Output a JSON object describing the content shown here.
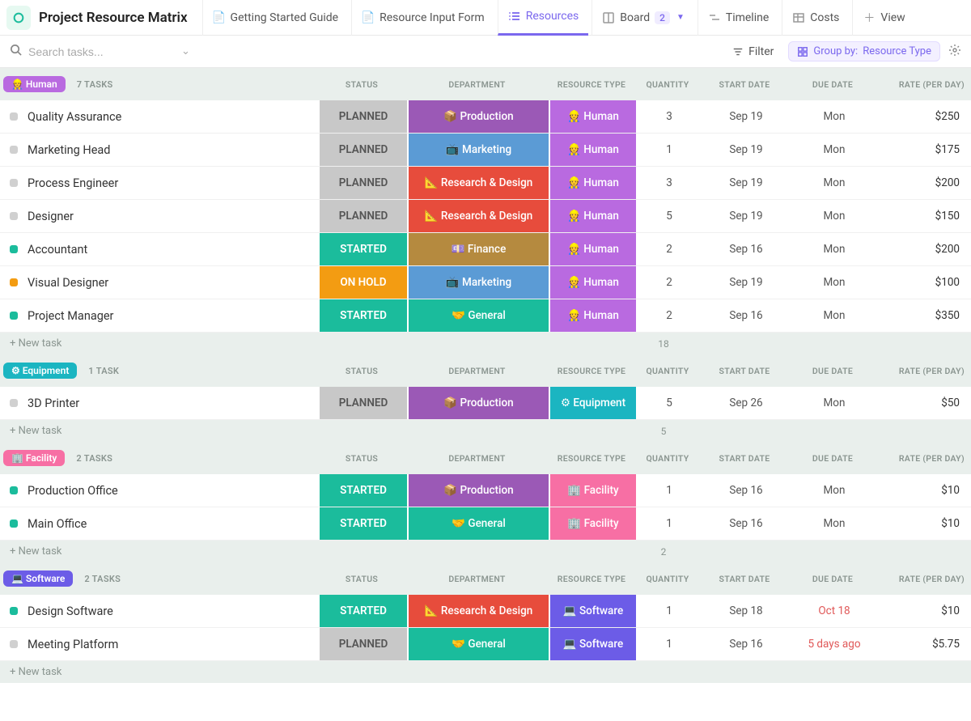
{
  "header": {
    "title": "Project Resource Matrix",
    "tabs": [
      {
        "icon": "doc-pin",
        "label": "Getting Started Guide"
      },
      {
        "icon": "doc-pin",
        "label": "Resource Input Form"
      },
      {
        "icon": "list",
        "label": "Resources",
        "active": true
      },
      {
        "icon": "board",
        "label": "Board",
        "count": "2"
      },
      {
        "icon": "timeline",
        "label": "Timeline"
      },
      {
        "icon": "table",
        "label": "Costs"
      },
      {
        "icon": "plus",
        "label": "View"
      }
    ]
  },
  "subbar": {
    "search_placeholder": "Search tasks...",
    "filter_label": "Filter",
    "groupby_prefix": "Group by:",
    "groupby_value": "Resource Type"
  },
  "columns": {
    "status": "STATUS",
    "department": "DEPARTMENT",
    "resource_type": "RESOURCE TYPE",
    "quantity": "QUANTITY",
    "start_date": "START DATE",
    "due_date": "DUE DATE",
    "rate": "RATE (PER DAY)"
  },
  "newtask_label": "+ New task",
  "groups": [
    {
      "pill_class": "pill-human",
      "pill_label": "👷 Human",
      "task_count": "7 TASKS",
      "rows": [
        {
          "name": "Quality Assurance",
          "status": "PLANNED",
          "status_class": "tag-planned",
          "sq": "sq-planned",
          "dept": "📦 Production",
          "dept_class": "dept-prod",
          "rtype": "👷 Human",
          "rtype_class": "rt-human",
          "qty": "3",
          "start": "Sep 19",
          "due": "Mon",
          "rate": "$250"
        },
        {
          "name": "Marketing Head",
          "status": "PLANNED",
          "status_class": "tag-planned",
          "sq": "sq-planned",
          "dept": "📺 Marketing",
          "dept_class": "dept-mkt",
          "rtype": "👷 Human",
          "rtype_class": "rt-human",
          "qty": "1",
          "start": "Sep 19",
          "due": "Mon",
          "rate": "$175"
        },
        {
          "name": "Process Engineer",
          "status": "PLANNED",
          "status_class": "tag-planned",
          "sq": "sq-planned",
          "dept": "📐 Research & Design",
          "dept_class": "dept-rd",
          "rtype": "👷 Human",
          "rtype_class": "rt-human",
          "qty": "3",
          "start": "Sep 19",
          "due": "Mon",
          "rate": "$200"
        },
        {
          "name": "Designer",
          "status": "PLANNED",
          "status_class": "tag-planned",
          "sq": "sq-planned",
          "dept": "📐 Research & Design",
          "dept_class": "dept-rd",
          "rtype": "👷 Human",
          "rtype_class": "rt-human",
          "qty": "5",
          "start": "Sep 19",
          "due": "Mon",
          "rate": "$150"
        },
        {
          "name": "Accountant",
          "status": "STARTED",
          "status_class": "tag-started",
          "sq": "sq-started",
          "dept": "💷 Finance",
          "dept_class": "dept-fin",
          "rtype": "👷 Human",
          "rtype_class": "rt-human",
          "qty": "2",
          "start": "Sep 16",
          "due": "Mon",
          "rate": "$200"
        },
        {
          "name": "Visual Designer",
          "status": "ON HOLD",
          "status_class": "tag-hold",
          "sq": "sq-hold",
          "dept": "📺 Marketing",
          "dept_class": "dept-mkt",
          "rtype": "👷 Human",
          "rtype_class": "rt-human",
          "qty": "2",
          "start": "Sep 19",
          "due": "Mon",
          "rate": "$100"
        },
        {
          "name": "Project Manager",
          "status": "STARTED",
          "status_class": "tag-started",
          "sq": "sq-started",
          "dept": "🤝 General",
          "dept_class": "dept-gen",
          "rtype": "👷 Human",
          "rtype_class": "rt-human",
          "qty": "2",
          "start": "Sep 16",
          "due": "Mon",
          "rate": "$350"
        }
      ],
      "qty_sum": "18"
    },
    {
      "pill_class": "pill-equip",
      "pill_label": "⚙ Equipment",
      "task_count": "1 TASK",
      "rows": [
        {
          "name": "3D Printer",
          "status": "PLANNED",
          "status_class": "tag-planned",
          "sq": "sq-planned",
          "dept": "📦 Production",
          "dept_class": "dept-prod",
          "rtype": "⚙ Equipment",
          "rtype_class": "rt-equip",
          "qty": "5",
          "start": "Sep 26",
          "due": "Mon",
          "rate": "$50"
        }
      ],
      "qty_sum": "5"
    },
    {
      "pill_class": "pill-fac",
      "pill_label": "🏢 Facility",
      "task_count": "2 TASKS",
      "rows": [
        {
          "name": "Production Office",
          "status": "STARTED",
          "status_class": "tag-started",
          "sq": "sq-started",
          "dept": "📦 Production",
          "dept_class": "dept-prod",
          "rtype": "🏢 Facility",
          "rtype_class": "rt-fac",
          "qty": "1",
          "start": "Sep 16",
          "due": "Mon",
          "rate": "$10"
        },
        {
          "name": "Main Office",
          "status": "STARTED",
          "status_class": "tag-started",
          "sq": "sq-started",
          "dept": "🤝 General",
          "dept_class": "dept-gen",
          "rtype": "🏢 Facility",
          "rtype_class": "rt-fac",
          "qty": "1",
          "start": "Sep 16",
          "due": "Mon",
          "rate": "$10"
        }
      ],
      "qty_sum": "2"
    },
    {
      "pill_class": "pill-soft",
      "pill_label": "💻 Software",
      "task_count": "2 TASKS",
      "rows": [
        {
          "name": "Design Software",
          "status": "STARTED",
          "status_class": "tag-started",
          "sq": "sq-started",
          "dept": "📐 Research & Design",
          "dept_class": "dept-rd",
          "rtype": "💻 Software",
          "rtype_class": "rt-soft",
          "qty": "1",
          "start": "Sep 18",
          "due": "Oct 18",
          "due_class": "overdue",
          "rate": "$10"
        },
        {
          "name": "Meeting Platform",
          "status": "PLANNED",
          "status_class": "tag-planned",
          "sq": "sq-planned",
          "dept": "🤝 General",
          "dept_class": "dept-gen",
          "rtype": "💻 Software",
          "rtype_class": "rt-soft",
          "qty": "1",
          "start": "Sep 16",
          "due": "5 days ago",
          "due_class": "overdue",
          "rate": "$5.75"
        }
      ],
      "qty_sum": ""
    }
  ]
}
